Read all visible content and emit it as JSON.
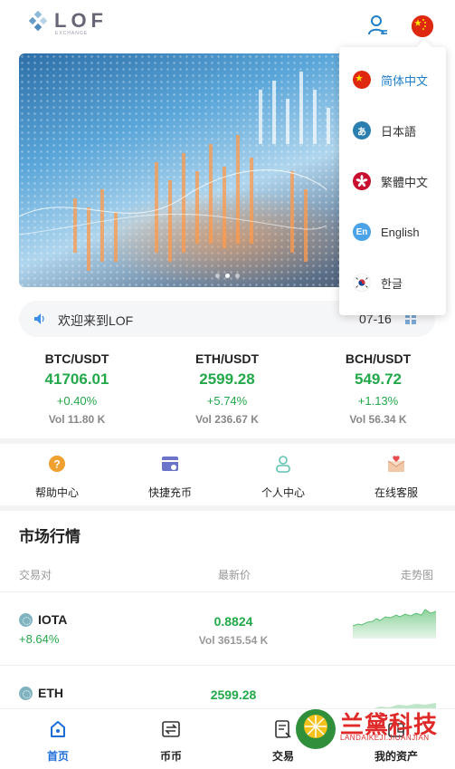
{
  "header": {
    "logo_text": "LOF",
    "logo_sub": "EXCHANGE"
  },
  "notice": {
    "text": "欢迎来到LOF",
    "date": "07-16"
  },
  "tickers": [
    {
      "pair": "BTC/USDT",
      "price": "41706.01",
      "change": "+0.40%",
      "volume": "Vol 11.80 K"
    },
    {
      "pair": "ETH/USDT",
      "price": "2599.28",
      "change": "+5.74%",
      "volume": "Vol 236.67 K"
    },
    {
      "pair": "BCH/USDT",
      "price": "549.72",
      "change": "+1.13%",
      "volume": "Vol 56.34 K"
    }
  ],
  "quick_menu": [
    {
      "label": "帮助中心",
      "icon": "help-icon"
    },
    {
      "label": "快捷充币",
      "icon": "deposit-icon"
    },
    {
      "label": "个人中心",
      "icon": "user-center-icon"
    },
    {
      "label": "在线客服",
      "icon": "customer-service-icon"
    }
  ],
  "market": {
    "title": "市场行情",
    "headers": {
      "pair": "交易对",
      "price": "最新价",
      "trend": "走势图"
    },
    "rows": [
      {
        "name": "IOTA",
        "change": "+8.64%",
        "price": "0.8824",
        "volume": "Vol 3615.54 K"
      },
      {
        "name": "ETH",
        "change": "",
        "price": "2599.28",
        "volume": ""
      }
    ]
  },
  "tabbar": [
    {
      "label": "首页",
      "icon": "home-icon",
      "active": true
    },
    {
      "label": "币币",
      "icon": "exchange-icon",
      "active": false
    },
    {
      "label": "交易",
      "icon": "trade-icon",
      "active": false
    },
    {
      "label": "我的资产",
      "icon": "assets-icon",
      "active": false
    }
  ],
  "language_menu": [
    {
      "label": "简体中文",
      "flag": "cn-flag-icon",
      "selected": true
    },
    {
      "label": "日本語",
      "flag": "jp-icon",
      "glyph": "あ",
      "selected": false
    },
    {
      "label": "繁體中文",
      "flag": "hk-flag-icon",
      "selected": false
    },
    {
      "label": "English",
      "flag": "en-icon",
      "glyph": "En",
      "selected": false
    },
    {
      "label": "한글",
      "flag": "kr-flag-icon",
      "selected": false
    }
  ],
  "watermark": {
    "zh": "兰黛科技",
    "en": "LANDAIKEJI.JIUANJIAN"
  },
  "colors": {
    "up": "#23a84a",
    "accent": "#1e6ed8",
    "selected_lang": "#1e7fc8"
  }
}
